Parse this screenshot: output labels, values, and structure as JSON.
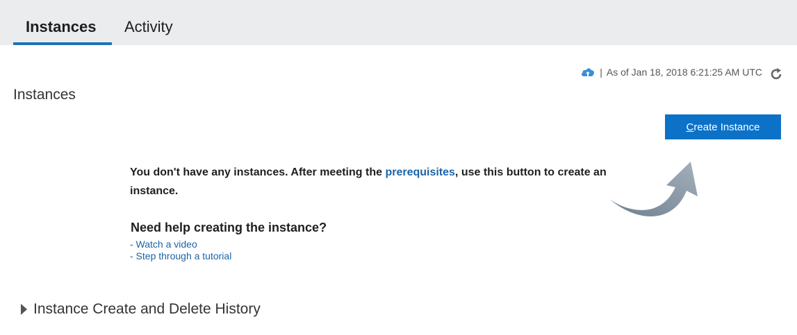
{
  "tabs": [
    {
      "label": "Instances",
      "active": true
    },
    {
      "label": "Activity",
      "active": false
    }
  ],
  "status": {
    "separator": "|",
    "timestamp": "As of Jan 18, 2018 6:21:25 AM UTC",
    "cloud_icon": "cloud-upload-icon",
    "refresh_icon": "refresh-icon"
  },
  "page_title": "Instances",
  "create_button": {
    "accel": "C",
    "rest": "reate Instance"
  },
  "empty_state": {
    "text_before": "You don't have any instances. After meeting the ",
    "link": "prerequisites",
    "text_after": ", use this button to create an instance."
  },
  "help": {
    "title": "Need help creating the instance?",
    "links": [
      "- Watch a video",
      "- Step through a tutorial"
    ]
  },
  "history": {
    "label": "Instance Create and Delete History",
    "icon": "caret-right-icon"
  },
  "colors": {
    "accent": "#0b72c8",
    "link": "#1c63a8",
    "tab_bg": "#ebecee"
  }
}
